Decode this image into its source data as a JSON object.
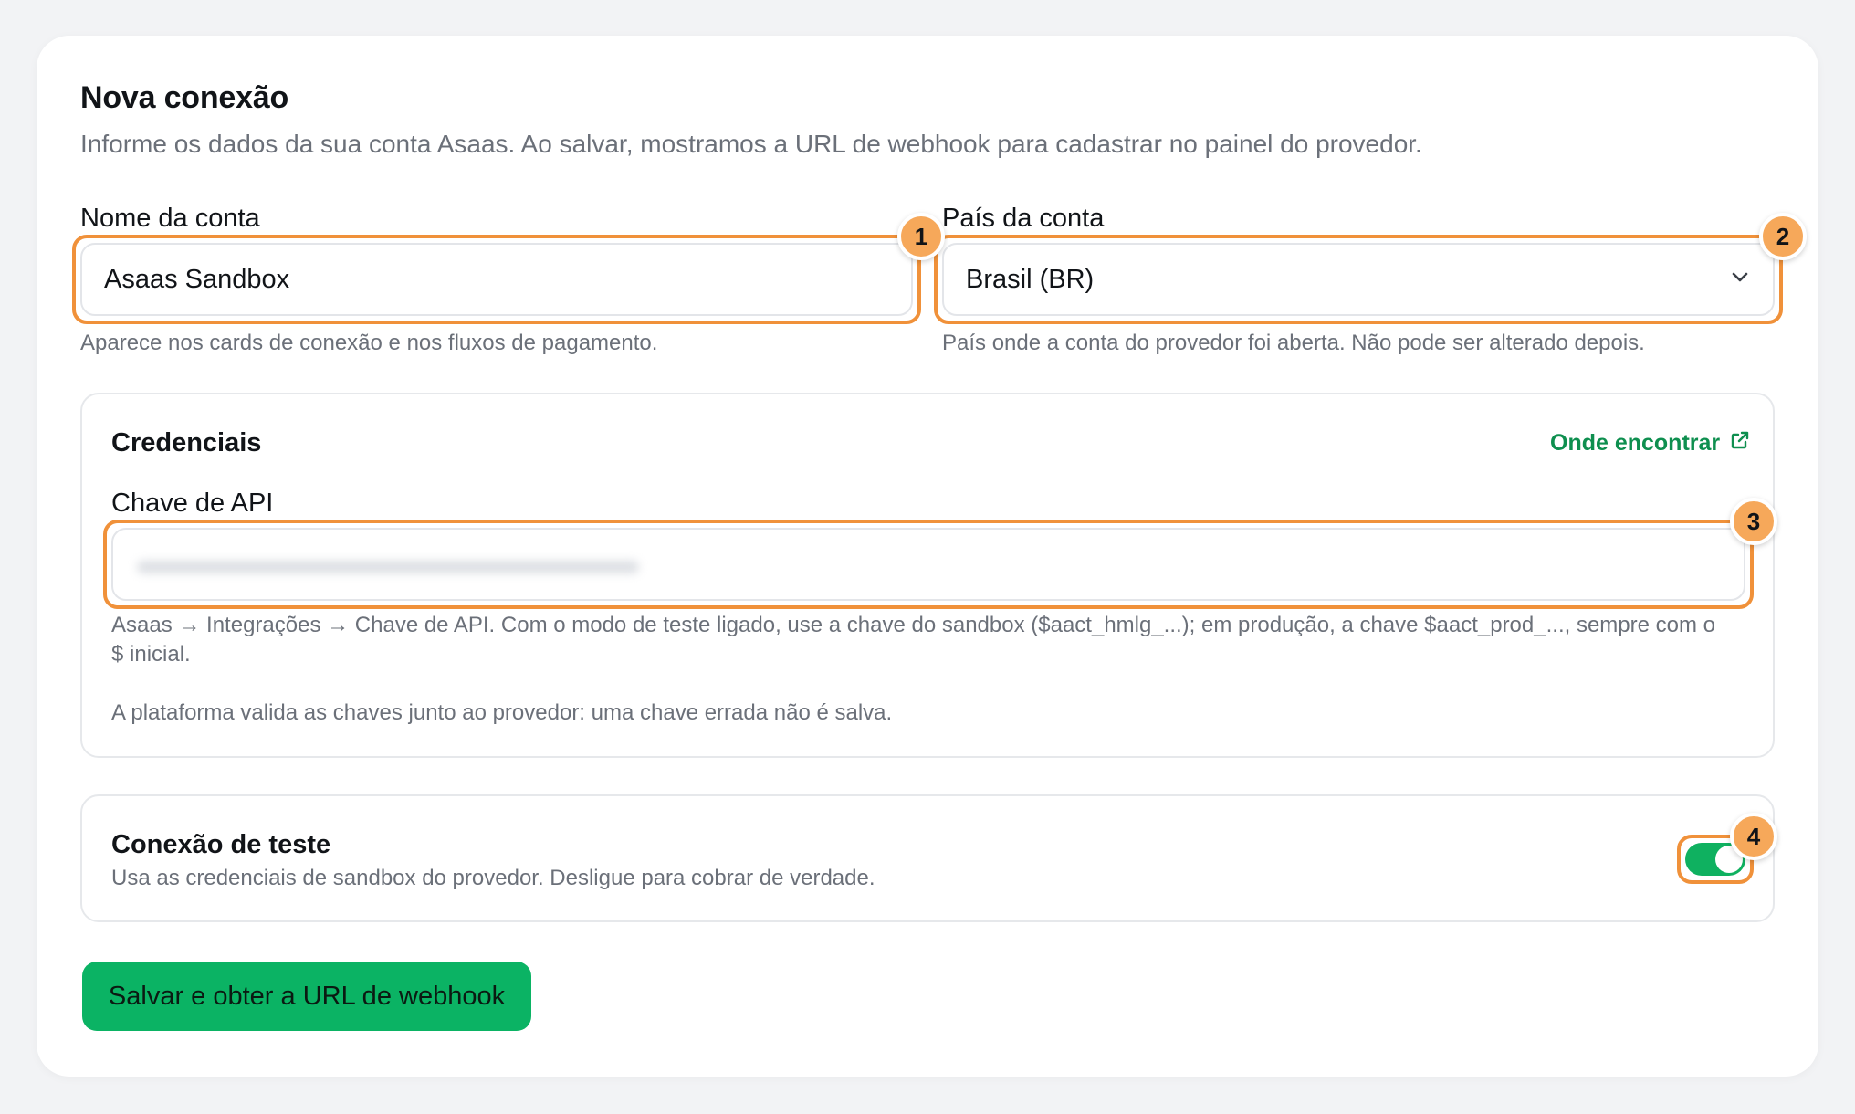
{
  "form": {
    "title": "Nova conexão",
    "subtitle": "Informe os dados da sua conta Asaas. Ao salvar, mostramos a URL de webhook para cadastrar no painel do provedor.",
    "account_name": {
      "label": "Nome da conta",
      "value": "Asaas Sandbox",
      "hint": "Aparece nos cards de conexão e nos fluxos de pagamento."
    },
    "country": {
      "label": "País da conta",
      "selected": "Brasil (BR)",
      "hint": "País onde a conta do provedor foi aberta. Não pode ser alterado depois."
    },
    "credentials": {
      "title": "Credenciais",
      "help_link": "Onde encontrar",
      "api_key_label": "Chave de API",
      "api_key_hint_line1": "Asaas → Integrações → Chave de API. Com o modo de teste ligado, use a chave do sandbox ($aact_hmlg_...); em produção, a chave $aact_prod_..., sempre com o",
      "api_key_hint_line2": "$ inicial.",
      "validation_note": "A plataforma valida as chaves junto ao provedor: uma chave errada não é salva."
    },
    "test_connection": {
      "title": "Conexão de teste",
      "description": "Usa as credenciais de sandbox do provedor. Desligue para cobrar de verdade.",
      "enabled": true
    },
    "submit_label": "Salvar e obter a URL de webhook"
  },
  "annotations": [
    "1",
    "2",
    "3",
    "4"
  ],
  "colors": {
    "accent_green": "#0bb364",
    "link_green": "#0e8f4f",
    "highlight_orange": "#f0913a",
    "badge_orange": "#f6a85a"
  }
}
